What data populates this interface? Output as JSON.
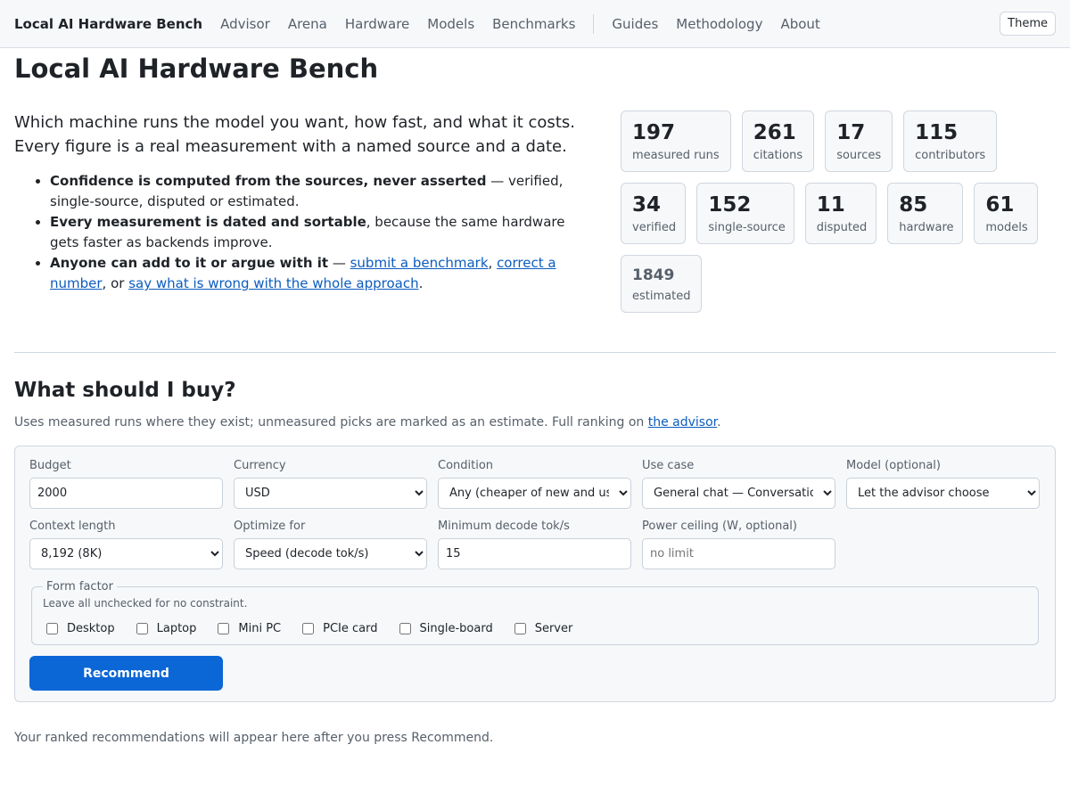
{
  "nav": {
    "brand": "Local AI Hardware Bench",
    "links": [
      "Advisor",
      "Arena",
      "Hardware",
      "Models",
      "Benchmarks"
    ],
    "secondary_links": [
      "Guides",
      "Methodology",
      "About"
    ],
    "theme_button": "Theme"
  },
  "page_title": "Local AI Hardware Bench",
  "lead": "Which machine runs the model you want, how fast, and what it costs. Every figure is a real measurement with a named source and a date.",
  "points": [
    {
      "bold": "Confidence is computed from the sources, never asserted",
      "rest": " — verified, single-source, disputed or estimated."
    },
    {
      "bold": "Every measurement is dated and sortable",
      "rest": ", because the same hardware gets faster as backends improve."
    },
    {
      "bold": "Anyone can add to it or argue with it",
      "rest1": " — ",
      "link1": "submit a benchmark",
      "sep1": ", ",
      "link2": "correct a number",
      "sep2": ", or ",
      "link3": "say what is wrong with the whole approach",
      "end": "."
    }
  ],
  "stats": {
    "measured_runs": {
      "value": "197",
      "label": "measured runs"
    },
    "citations": {
      "value": "261",
      "label": "citations"
    },
    "sources": {
      "value": "17",
      "label": "sources"
    },
    "contributors": {
      "value": "115",
      "label": "contributors"
    },
    "verified": {
      "value": "34",
      "label": "verified"
    },
    "single_source": {
      "value": "152",
      "label": "single-source"
    },
    "disputed": {
      "value": "11",
      "label": "disputed"
    },
    "hardware": {
      "value": "85",
      "label": "hardware"
    },
    "models": {
      "value": "61",
      "label": "models"
    },
    "estimated": {
      "value": "1849",
      "label": "estimated"
    }
  },
  "buy": {
    "heading": "What should I buy?",
    "subtext_pre": "Uses measured runs where they exist; unmeasured picks are marked as an estimate. Full ranking on ",
    "subtext_link": "the advisor",
    "subtext_post": "."
  },
  "form": {
    "budget": {
      "label": "Budget",
      "value": "2000"
    },
    "currency": {
      "label": "Currency",
      "value": "USD"
    },
    "condition": {
      "label": "Condition",
      "value": "Any (cheaper of new and used)"
    },
    "use_case": {
      "label": "Use case",
      "value": "General chat — Conversational"
    },
    "model": {
      "label": "Model (optional)",
      "value": "Let the advisor choose"
    },
    "context": {
      "label": "Context length",
      "value": "8,192 (8K)"
    },
    "optimize": {
      "label": "Optimize for",
      "value": "Speed (decode tok/s)"
    },
    "min_decode": {
      "label": "Minimum decode tok/s",
      "value": "15"
    },
    "power": {
      "label": "Power ceiling (W, optional)",
      "placeholder": "no limit"
    },
    "form_factor": {
      "legend": "Form factor",
      "note": "Leave all unchecked for no constraint.",
      "options": [
        "Desktop",
        "Laptop",
        "Mini PC",
        "PCIe card",
        "Single-board",
        "Server"
      ]
    },
    "recommend_label": "Recommend"
  },
  "result_note": "Your ranked recommendations will appear here after you press Recommend."
}
